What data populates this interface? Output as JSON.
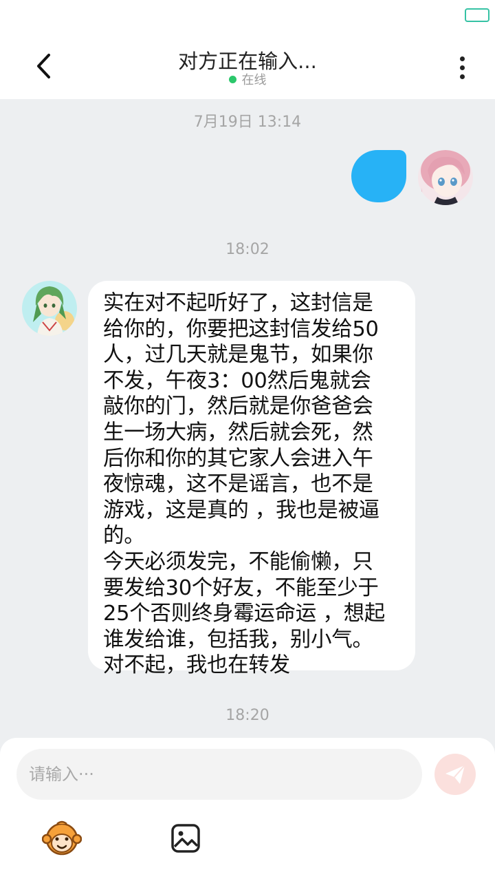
{
  "header": {
    "title": "对方正在输入...",
    "status_text": "在线",
    "status_color": "#2bc76b"
  },
  "messages": {
    "timestamp_1": "7月19日 13:14",
    "timestamp_2": "18:02",
    "timestamp_3": "18:20",
    "received_text": "实在对不起听好了，这封信是\n给你的，你要把这封信发给50\n人，过几天就是鬼节，如果你\n不发，午夜3：00然后鬼就会\n敲你的门，然后就是你爸爸会\n生一场大病，然后就会死，然\n后你和你的其它家人会进入午\n夜惊魂，这不是谣言，也不是\n游戏，这是真的 ，我也是被逼\n的。\n今天必须发完，不能偷懒，只\n要发给30个好友，不能至少于\n25个否则终身霉运命运 ，想起\n谁发给谁，包括我，别小气。\n对不起，我也在转发",
    "sent_bubble_color": "#27b2f6"
  },
  "input": {
    "placeholder": "请输入···",
    "value": ""
  },
  "toolbar": {
    "icons": [
      "monkey-emoji-icon",
      "image-icon"
    ]
  },
  "icons": {
    "back": "chevron-left-icon",
    "more": "more-vertical-icon",
    "send": "send-icon",
    "battery": "battery-icon"
  }
}
